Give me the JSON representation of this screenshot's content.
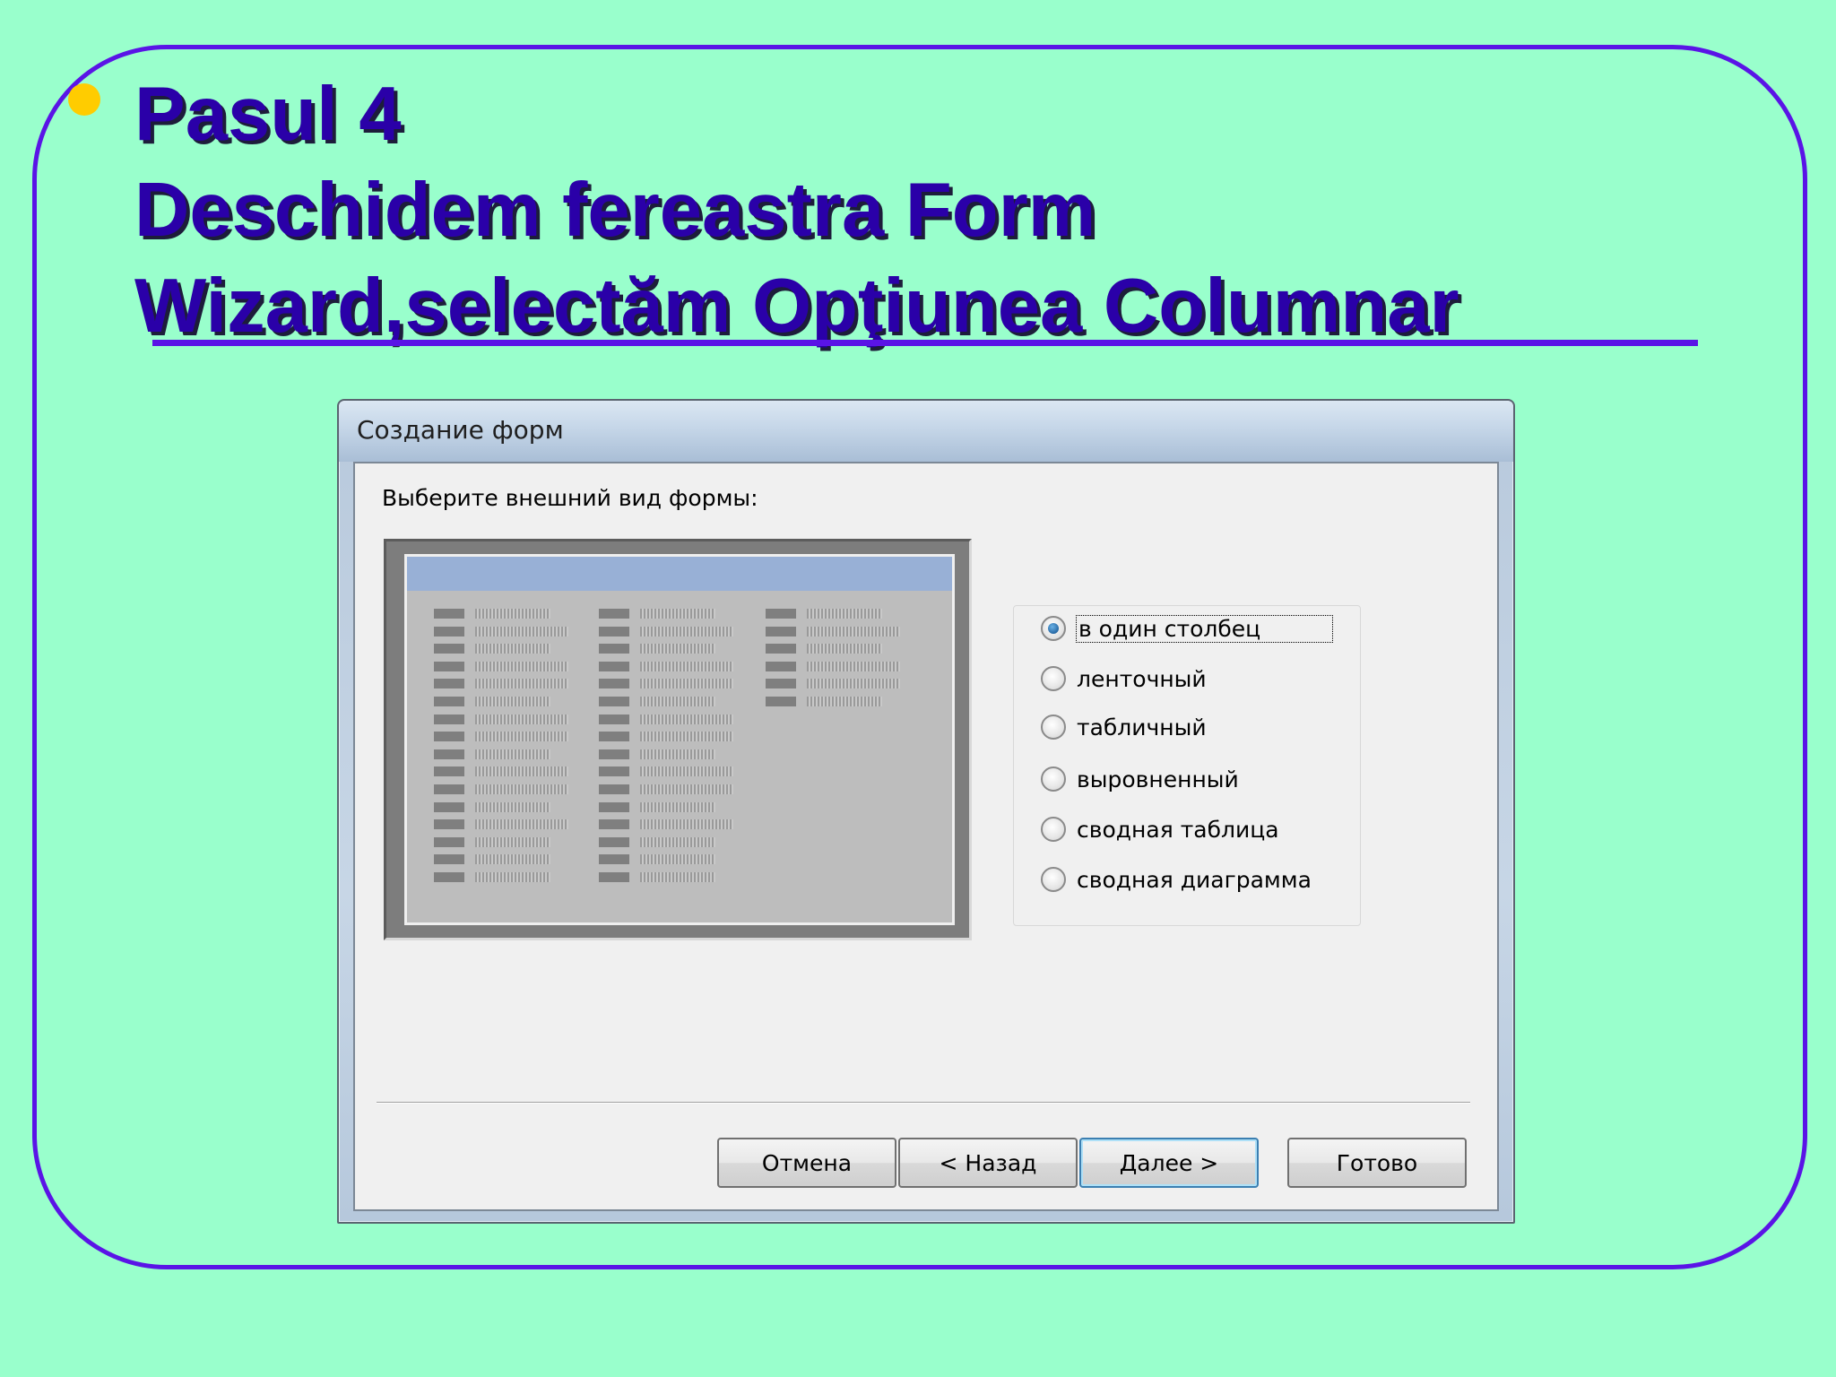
{
  "slide": {
    "title_lines": [
      "Pasul 4",
      "Deschidem fereastra Form",
      "Wizard,selectăm Opţiunea Columnar"
    ]
  },
  "colors": {
    "background": "#99ffcc",
    "frame": "#5a14e6",
    "title": "#2a00a8",
    "bullet": "#ffcc00"
  },
  "dialog": {
    "title": "Создание форм",
    "prompt": "Выберите внешний вид формы:",
    "options": [
      {
        "label": "в один столбец",
        "selected": true
      },
      {
        "label": "ленточный",
        "selected": false
      },
      {
        "label": "табличный",
        "selected": false
      },
      {
        "label": "выровненный",
        "selected": false
      },
      {
        "label": "сводная таблица",
        "selected": false
      },
      {
        "label": "сводная диаграмма",
        "selected": false
      }
    ],
    "buttons": {
      "cancel": "Отмена",
      "back": "< Назад",
      "next": "Далее >",
      "finish": "Готово"
    }
  }
}
